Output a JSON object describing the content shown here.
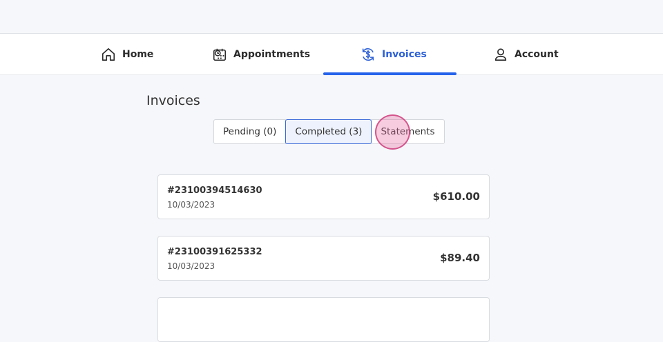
{
  "nav": {
    "items": [
      {
        "label": "Home",
        "icon": "home-icon"
      },
      {
        "label": "Appointments",
        "icon": "calendar-clock-icon"
      },
      {
        "label": "Invoices",
        "icon": "dollar-refresh-icon",
        "active": true
      },
      {
        "label": "Account",
        "icon": "user-icon"
      }
    ],
    "accent_color": "#2563eb"
  },
  "page": {
    "title": "Invoices"
  },
  "tabs": [
    {
      "label": "Pending (0)"
    },
    {
      "label": "Completed (3)",
      "selected": true
    },
    {
      "label": "Statements"
    }
  ],
  "invoices": [
    {
      "number": "#23100394514630",
      "date": "10/03/2023",
      "amount": "$610.00"
    },
    {
      "number": "#23100391625332",
      "date": "10/03/2023",
      "amount": "$89.40"
    }
  ]
}
